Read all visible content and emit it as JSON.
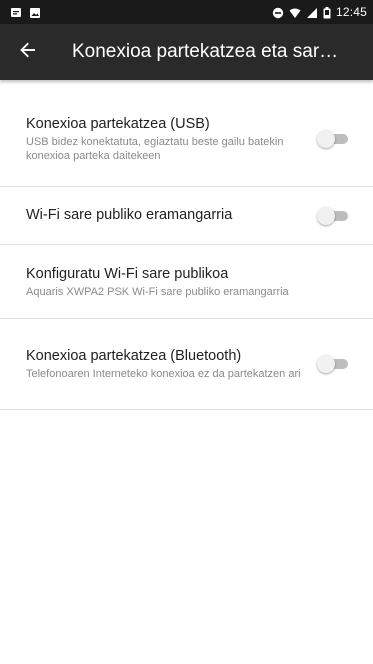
{
  "status_bar": {
    "time": "12:45",
    "left_icons": [
      "notification-icon",
      "image-icon"
    ],
    "right_icons": [
      "do-not-disturb-icon",
      "wifi-icon",
      "signal-icon",
      "battery-icon"
    ]
  },
  "app_bar": {
    "back_icon": "arrow-back-icon",
    "title": "Konexioa partekatzea eta sar…"
  },
  "settings": [
    {
      "title": "Konexioa partekatzea (USB)",
      "subtitle": "USB bidez konektatuta, egiaztatu beste gailu batekin konexioa parteka daitekeen",
      "switch": true,
      "enabled": false
    },
    {
      "title": "Wi-Fi sare publiko eramangarria",
      "subtitle": "",
      "switch": true,
      "enabled": false
    },
    {
      "title": "Konfiguratu Wi-Fi sare publikoa",
      "subtitle": "Aquaris XWPA2 PSK Wi-Fi sare publiko eramangarria",
      "switch": false
    },
    {
      "title": "Konexioa partekatzea (Bluetooth)",
      "subtitle": "Telefonoaren Interneteko konexioa ez da partekatzen ari",
      "switch": true,
      "enabled": false
    }
  ]
}
